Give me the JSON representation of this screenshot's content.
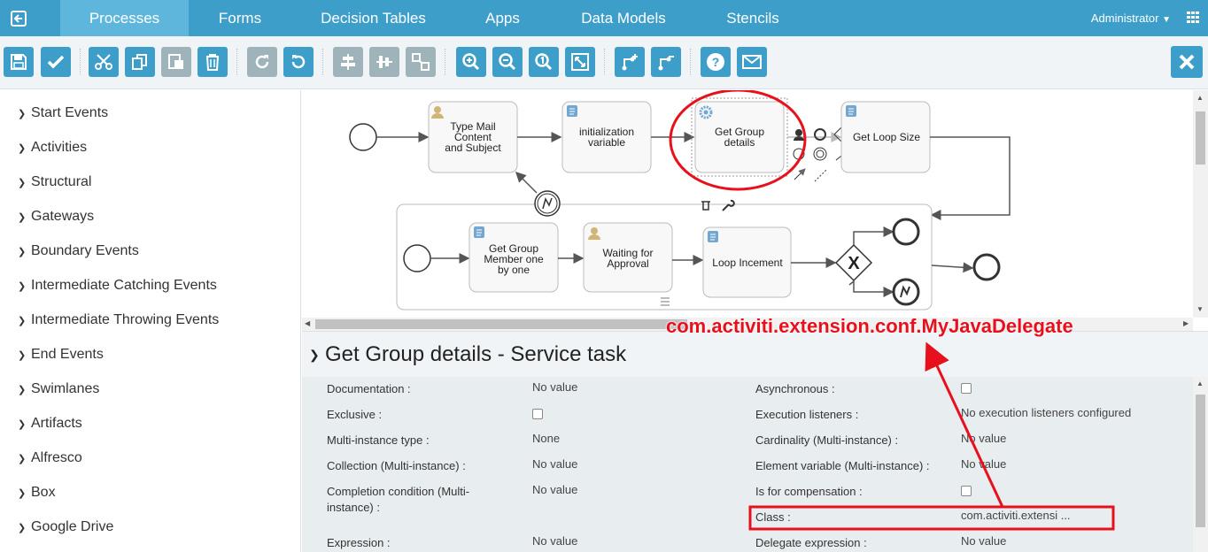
{
  "nav": {
    "tabs": [
      {
        "label": "Processes"
      },
      {
        "label": "Forms"
      },
      {
        "label": "Decision Tables"
      },
      {
        "label": "Apps"
      },
      {
        "label": "Data Models"
      },
      {
        "label": "Stencils"
      }
    ],
    "user": "Administrator",
    "back_icon": "back-arrow-icon",
    "grid_icon": "app-grid-icon"
  },
  "toolbar": {
    "icons": [
      "save-icon",
      "validate-check-icon",
      "cut-icon",
      "copy-icon",
      "paste-icon",
      "delete-icon",
      "redo-icon",
      "undo-icon",
      "align-horizontal-icon",
      "align-vertical-icon",
      "same-size-icon",
      "zoom-in-icon",
      "zoom-out-icon",
      "zoom-actual-icon",
      "zoom-fit-icon",
      "bendpoint-add-icon",
      "bendpoint-remove-icon",
      "help-icon",
      "mail-icon",
      "close-icon"
    ],
    "accent": "#3c9ec9",
    "disabled": "#9fb3ba"
  },
  "palette": {
    "items": [
      {
        "label": "Start Events"
      },
      {
        "label": "Activities"
      },
      {
        "label": "Structural"
      },
      {
        "label": "Gateways"
      },
      {
        "label": "Boundary Events"
      },
      {
        "label": "Intermediate Catching Events"
      },
      {
        "label": "Intermediate Throwing Events"
      },
      {
        "label": "End Events"
      },
      {
        "label": "Swimlanes"
      },
      {
        "label": "Artifacts"
      },
      {
        "label": "Alfresco"
      },
      {
        "label": "Box"
      },
      {
        "label": "Google Drive"
      }
    ]
  },
  "diagram": {
    "tasks": [
      {
        "label_lines": [
          "Type Mail",
          "Content",
          "and Subject"
        ],
        "kind": "user-task"
      },
      {
        "label_lines": [
          "initialization",
          "variable"
        ],
        "kind": "script-task"
      },
      {
        "label_lines": [
          "Get Group",
          "details"
        ],
        "kind": "service-task"
      },
      {
        "label_lines": [
          "Get Loop Size"
        ],
        "kind": "script-task"
      },
      {
        "label_lines": [
          "Get Group",
          "Member one",
          "by one"
        ],
        "kind": "script-task"
      },
      {
        "label_lines": [
          "Waiting for",
          "Approval"
        ],
        "kind": "user-task"
      },
      {
        "label_lines": [
          "Loop Incement"
        ],
        "kind": "script-task"
      }
    ],
    "gateway_symbol": "X"
  },
  "properties": {
    "title": "Get Group details - Service task",
    "left": [
      {
        "label": "Documentation :",
        "value": "No value"
      },
      {
        "label": "Exclusive :",
        "checkbox": true
      },
      {
        "label": "Multi-instance type :",
        "value": "None"
      },
      {
        "label": "Collection (Multi-instance) :",
        "value": "No value"
      },
      {
        "label": "Completion condition (Multi-",
        "label2": "instance) :",
        "value": "No value"
      },
      {
        "label": "Expression :",
        "value": "No value"
      }
    ],
    "right": [
      {
        "label": "Asynchronous :",
        "checkbox": true
      },
      {
        "label": "Execution listeners :",
        "value": "No execution listeners configured"
      },
      {
        "label": "Cardinality (Multi-instance) :",
        "value": "No value"
      },
      {
        "label": "Element variable (Multi-instance) :",
        "value": "No value"
      },
      {
        "label": "Is for compensation :",
        "checkbox": true
      },
      {
        "label": "Class :",
        "value": "com.activiti.extensi ..."
      },
      {
        "label": "Delegate expression :",
        "value": "No value"
      }
    ]
  },
  "annotation": {
    "text": "com.activiti.extension.conf.MyJavaDelegate",
    "color": "#e8101c"
  }
}
